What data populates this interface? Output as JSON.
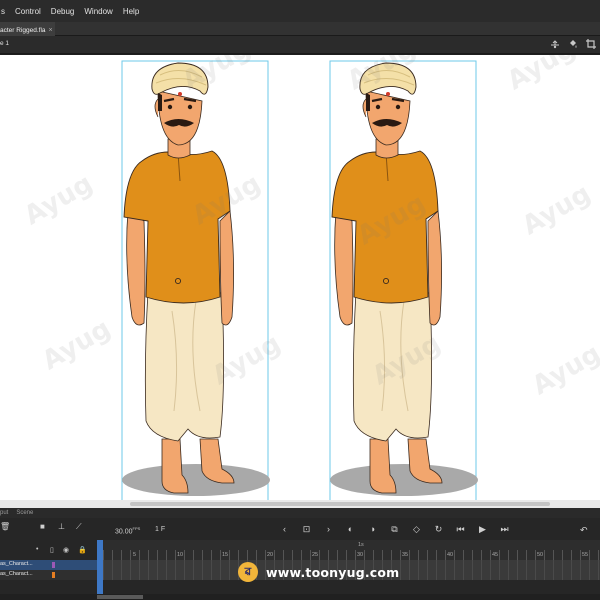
{
  "menu": {
    "items": [
      "s",
      "Control",
      "Debug",
      "Window",
      "Help"
    ]
  },
  "tab": {
    "label": "acter Rigged.fla",
    "close_icon": "close-icon"
  },
  "editbar": {
    "scene_label": "e 1",
    "icons": [
      "camera-icon",
      "paint-bucket-icon",
      "crop-icon"
    ]
  },
  "panel_tabs": [
    "put",
    "Scene"
  ],
  "timeline": {
    "fps": "30.00",
    "fps_unit": "FPS",
    "frame": "1",
    "frame_unit": "F",
    "ruler_labels": [
      "5",
      "10",
      "15",
      "20",
      "25",
      "30",
      "35",
      "40",
      "45",
      "50",
      "55"
    ],
    "seconds_label": "1s",
    "layers": [
      {
        "name": "as_Charact...",
        "color": "#9b59b6",
        "selected": true
      },
      {
        "name": "as_Charact...",
        "color": "#e67e22",
        "selected": false
      }
    ]
  },
  "brand": {
    "logo_letter": "ৱ",
    "url": "www.toonyug.com"
  },
  "watermark": {
    "text": "Ayug"
  },
  "colors": {
    "shirt": "#e08f1a",
    "dhoti": "#f6e7c4",
    "turban": "#f4e0a8",
    "skin": "#f2a66e",
    "bounding_box": "#6ec8e8",
    "playhead": "#3e78c6"
  }
}
